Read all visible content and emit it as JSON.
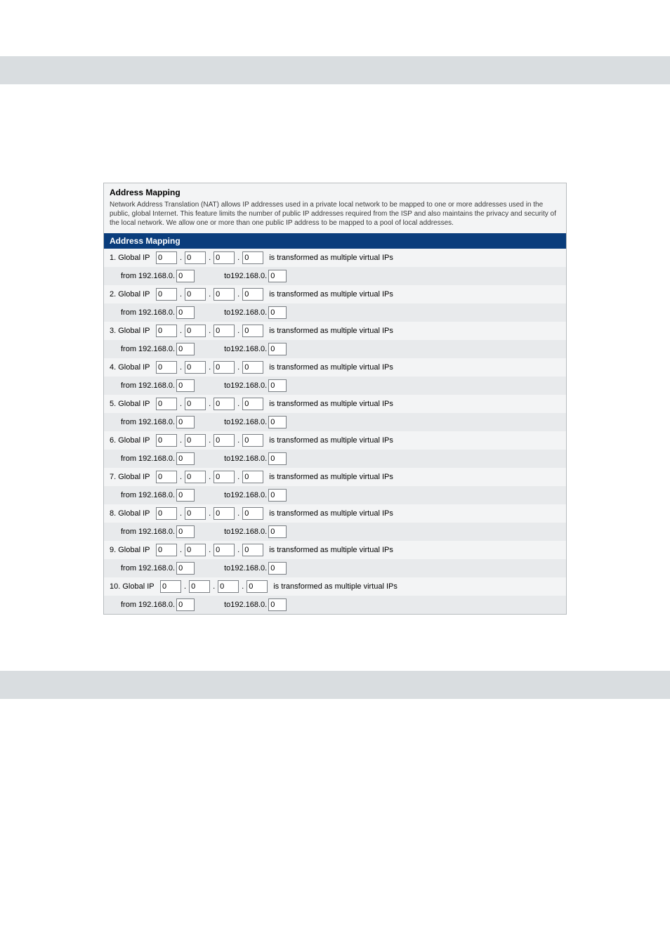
{
  "page": {
    "title": "Address Mapping",
    "description": "Network Address Translation (NAT) allows IP addresses used in a private local network to be mapped to one or more addresses used in the public, global Internet. This feature limits the number of public IP addresses required from the ISP and also maintains the privacy and security of the local network. We allow one or more than one public IP address to be mapped to a pool of local addresses.",
    "section_header": "Address Mapping",
    "labels": {
      "globalPrefix": "Global IP",
      "transformText": "is transformed as multiple virtual IPs",
      "fromPrefix": "from 192.168.0.",
      "toPrefix": "to192.168.0."
    }
  },
  "entries": [
    {
      "idx": "1.",
      "g1": "0",
      "g2": "0",
      "g3": "0",
      "g4": "0",
      "from": "0",
      "to": "0"
    },
    {
      "idx": "2.",
      "g1": "0",
      "g2": "0",
      "g3": "0",
      "g4": "0",
      "from": "0",
      "to": "0"
    },
    {
      "idx": "3.",
      "g1": "0",
      "g2": "0",
      "g3": "0",
      "g4": "0",
      "from": "0",
      "to": "0"
    },
    {
      "idx": "4.",
      "g1": "0",
      "g2": "0",
      "g3": "0",
      "g4": "0",
      "from": "0",
      "to": "0"
    },
    {
      "idx": "5.",
      "g1": "0",
      "g2": "0",
      "g3": "0",
      "g4": "0",
      "from": "0",
      "to": "0"
    },
    {
      "idx": "6.",
      "g1": "0",
      "g2": "0",
      "g3": "0",
      "g4": "0",
      "from": "0",
      "to": "0"
    },
    {
      "idx": "7.",
      "g1": "0",
      "g2": "0",
      "g3": "0",
      "g4": "0",
      "from": "0",
      "to": "0"
    },
    {
      "idx": "8.",
      "g1": "0",
      "g2": "0",
      "g3": "0",
      "g4": "0",
      "from": "0",
      "to": "0"
    },
    {
      "idx": "9.",
      "g1": "0",
      "g2": "0",
      "g3": "0",
      "g4": "0",
      "from": "0",
      "to": "0"
    },
    {
      "idx": "10.",
      "g1": "0",
      "g2": "0",
      "g3": "0",
      "g4": "0",
      "from": "0",
      "to": "0"
    }
  ]
}
